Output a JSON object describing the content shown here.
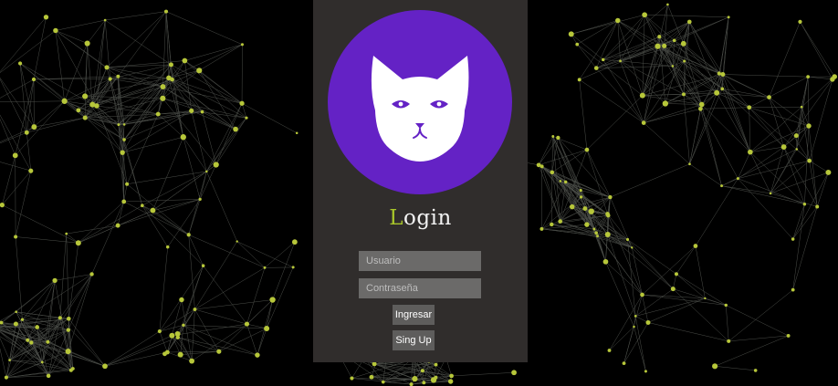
{
  "colors": {
    "background": "#000000",
    "panel": "#302d2c",
    "avatar_circle": "#6422c5",
    "accent": "#a8c52a",
    "network_node": "#b7c73a"
  },
  "avatar": {
    "icon": "cat-face-icon"
  },
  "login": {
    "title_first_letter": "L",
    "title_rest": "ogin",
    "username_placeholder": "Usuario",
    "password_placeholder": "Contraseña",
    "submit_label": "Ingresar",
    "signup_label": "Sing Up"
  }
}
